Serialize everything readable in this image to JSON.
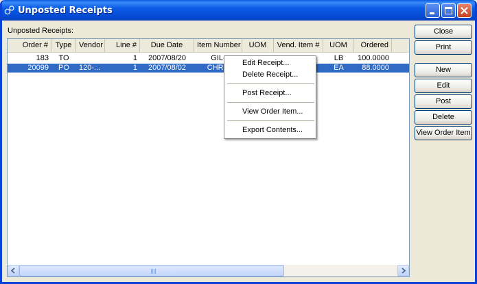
{
  "window": {
    "title": "Unposted Receipts"
  },
  "section_label": "Unposted Receipts:",
  "table": {
    "columns": [
      "Order #",
      "Type",
      "Vendor",
      "Line #",
      "Due Date",
      "Item Number",
      "UOM",
      "Vend. Item #",
      "UOM",
      "Ordered"
    ],
    "rows": [
      {
        "order": "183",
        "type": "TO",
        "vendor": "",
        "line": "1",
        "due": "2007/08/20",
        "item": "GIL-",
        "uom": "",
        "vend_item": "",
        "uom2": "LB",
        "ordered": "100.0000",
        "selected": false
      },
      {
        "order": "20099",
        "type": "PO",
        "vendor": "120-...",
        "line": "1",
        "due": "2007/08/02",
        "item": "CHRO",
        "uom": "",
        "vend_item": "",
        "uom2": "EA",
        "ordered": "88.0000",
        "selected": true
      }
    ]
  },
  "context_menu": {
    "items": [
      "Edit Receipt...",
      "Delete Receipt...",
      "Post Receipt...",
      "View Order Item...",
      "Export Contents..."
    ]
  },
  "buttons": {
    "close": "Close",
    "print": "Print",
    "new": "New",
    "edit": "Edit",
    "post": "Post",
    "delete": "Delete",
    "view_order_item": "View Order Item"
  },
  "colors": {
    "titlebar": "#0b5ce6",
    "selection": "#316ac5",
    "window_bg": "#ece9d8"
  }
}
